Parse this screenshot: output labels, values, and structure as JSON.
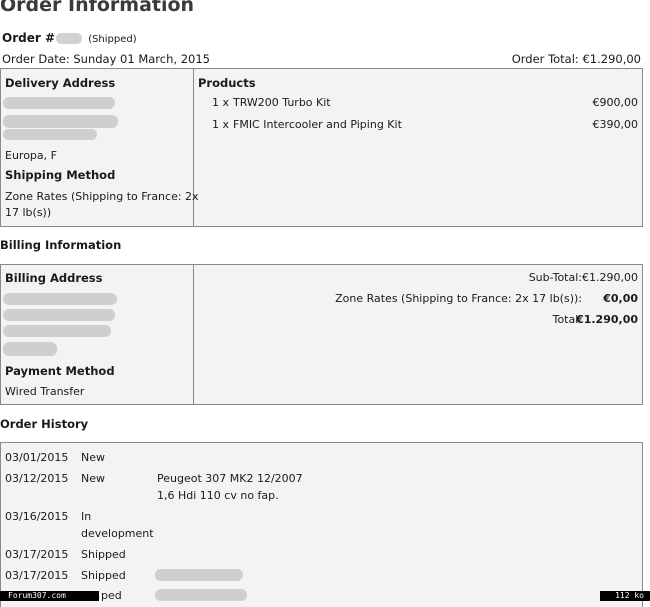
{
  "page_title": "Order Information",
  "order": {
    "label": "Order #",
    "status": "(Shipped)",
    "date": "Order Date: Sunday 01 March, 2015",
    "total": "Order Total: €1.290,00"
  },
  "delivery": {
    "heading": "Delivery Address",
    "city": "Europa, F",
    "shipping_method_heading": "Shipping Method",
    "shipping_method_line1": "Zone Rates (Shipping to France: 2x",
    "shipping_method_line2": "17 lb(s))"
  },
  "products": {
    "heading": "Products",
    "items": [
      {
        "qty": "1 x",
        "name": "TRW200 Turbo Kit",
        "price": "€900,00"
      },
      {
        "qty": "1 x",
        "name": "FMIC Intercooler and Piping Kit",
        "price": "€390,00"
      }
    ]
  },
  "billing_section_title": "Billing Information",
  "billing": {
    "heading": "Billing Address",
    "payment_method_heading": "Payment Method",
    "payment_method": "Wired Transfer"
  },
  "totals": {
    "subtotal_label": "Sub-Total:",
    "subtotal_value": "€1.290,00",
    "shipping_label": "Zone Rates (Shipping to France: 2x 17 lb(s)):",
    "shipping_value": "€0,00",
    "total_label": "Total:",
    "total_value": "€1.290,00"
  },
  "history_title": "Order History",
  "history": [
    {
      "date": "03/01/2015",
      "status": "New",
      "comment": ""
    },
    {
      "date": "03/12/2015",
      "status": "New",
      "comment": "Peugeot 307 MK2 12/2007",
      "comment2": "1,6 Hdi 110 cv no fap."
    },
    {
      "date": "03/16/2015",
      "status": "In",
      "status2": "development",
      "comment": ""
    },
    {
      "date": "03/17/2015",
      "status": "Shipped",
      "comment": ""
    },
    {
      "date": "03/17/2015",
      "status": "Shipped",
      "comment": ""
    },
    {
      "date": "",
      "status": "ped",
      "comment": ""
    }
  ],
  "footer": {
    "site": "Forum307.com",
    "size": "112 ko"
  }
}
